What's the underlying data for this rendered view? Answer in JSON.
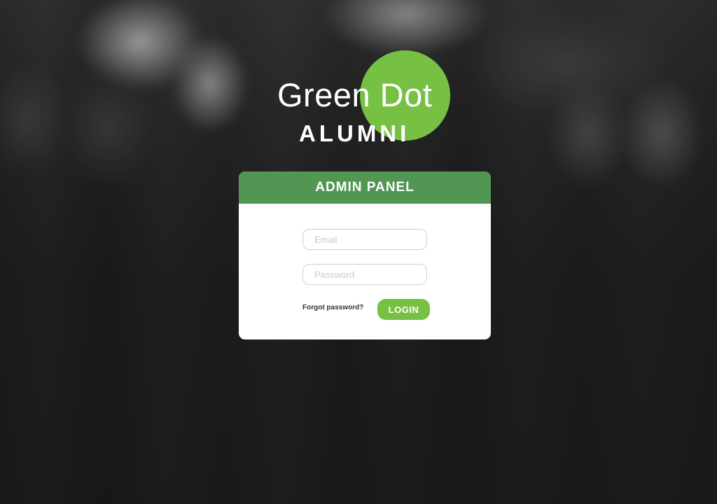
{
  "brand": {
    "name": "Green Dot",
    "subtitle": "ALUMNI",
    "accent_color": "#76c043"
  },
  "panel": {
    "title": "ADMIN PANEL",
    "header_color": "#529653",
    "email": {
      "placeholder": "Email",
      "value": ""
    },
    "password": {
      "placeholder": "Password",
      "value": ""
    },
    "forgot_label": "Forgot password?",
    "login_label": "LOGIN"
  }
}
